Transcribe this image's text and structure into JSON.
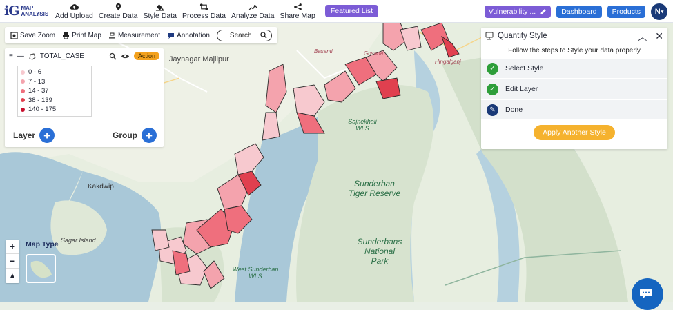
{
  "app": {
    "logo_mark": "iG",
    "logo_line1": "MAP",
    "logo_line2": "ANALYSIS"
  },
  "nav": [
    {
      "label": "Add Upload",
      "icon": "cloud-upload-icon"
    },
    {
      "label": "Create Data",
      "icon": "map-pin-icon"
    },
    {
      "label": "Style Data",
      "icon": "paint-bucket-icon"
    },
    {
      "label": "Process Data",
      "icon": "process-icon"
    },
    {
      "label": "Analyze Data",
      "icon": "analyze-icon"
    },
    {
      "label": "Share Map",
      "icon": "share-icon"
    }
  ],
  "featured_label": "Featured List",
  "vulnerability_label": "Vulnerability ...",
  "dashboard_label": "Dashboard",
  "products_label": "Products",
  "avatar_initial": "N",
  "toolbar": {
    "save_zoom": "Save Zoom",
    "print_map": "Print Map",
    "measurement": "Measurement",
    "annotation": "Annotation",
    "search_placeholder": "Search"
  },
  "layer": {
    "name": "TOTAL_CASE",
    "action_label": "Action",
    "legend": [
      {
        "range": "0 - 6",
        "color": "#f7c9cf"
      },
      {
        "range": "7 - 13",
        "color": "#f4a3ad"
      },
      {
        "range": "14 - 37",
        "color": "#ef6f7d"
      },
      {
        "range": "38 - 139",
        "color": "#e0404f"
      },
      {
        "range": "140 - 175",
        "color": "#c8102e"
      }
    ],
    "layer_label": "Layer",
    "group_label": "Group"
  },
  "quantity_style": {
    "title": "Quantity Style",
    "subtitle": "Follow the steps to Style your data properly",
    "steps": [
      {
        "label": "Select Style",
        "status": "done"
      },
      {
        "label": "Edit Layer",
        "status": "done"
      },
      {
        "label": "Done",
        "status": "current"
      }
    ],
    "apply_label": "Apply Another Style"
  },
  "map": {
    "type_label": "Map Type",
    "labels": {
      "jaynagar": "Jaynagar Majilpur",
      "kakdwip": "Kakdwip",
      "sagar": "Sagar Island",
      "sajnekhali": "Sajnekhali\nWLS",
      "sunderban_tiger": "Sunderban\nTiger Reserve",
      "sunderbans_np": "Sunderbans\nNational\nPark",
      "west_sunderban": "West Sunderban\nWLS",
      "basanti": "Basanti",
      "gosaba": "Gosaba",
      "hingalganj": "Hingalganj"
    }
  },
  "colors": {
    "accent_purple": "#7c5cd6",
    "accent_blue": "#2a6fd6",
    "success_green": "#2e9e3a",
    "apply_orange": "#f5b22e"
  }
}
